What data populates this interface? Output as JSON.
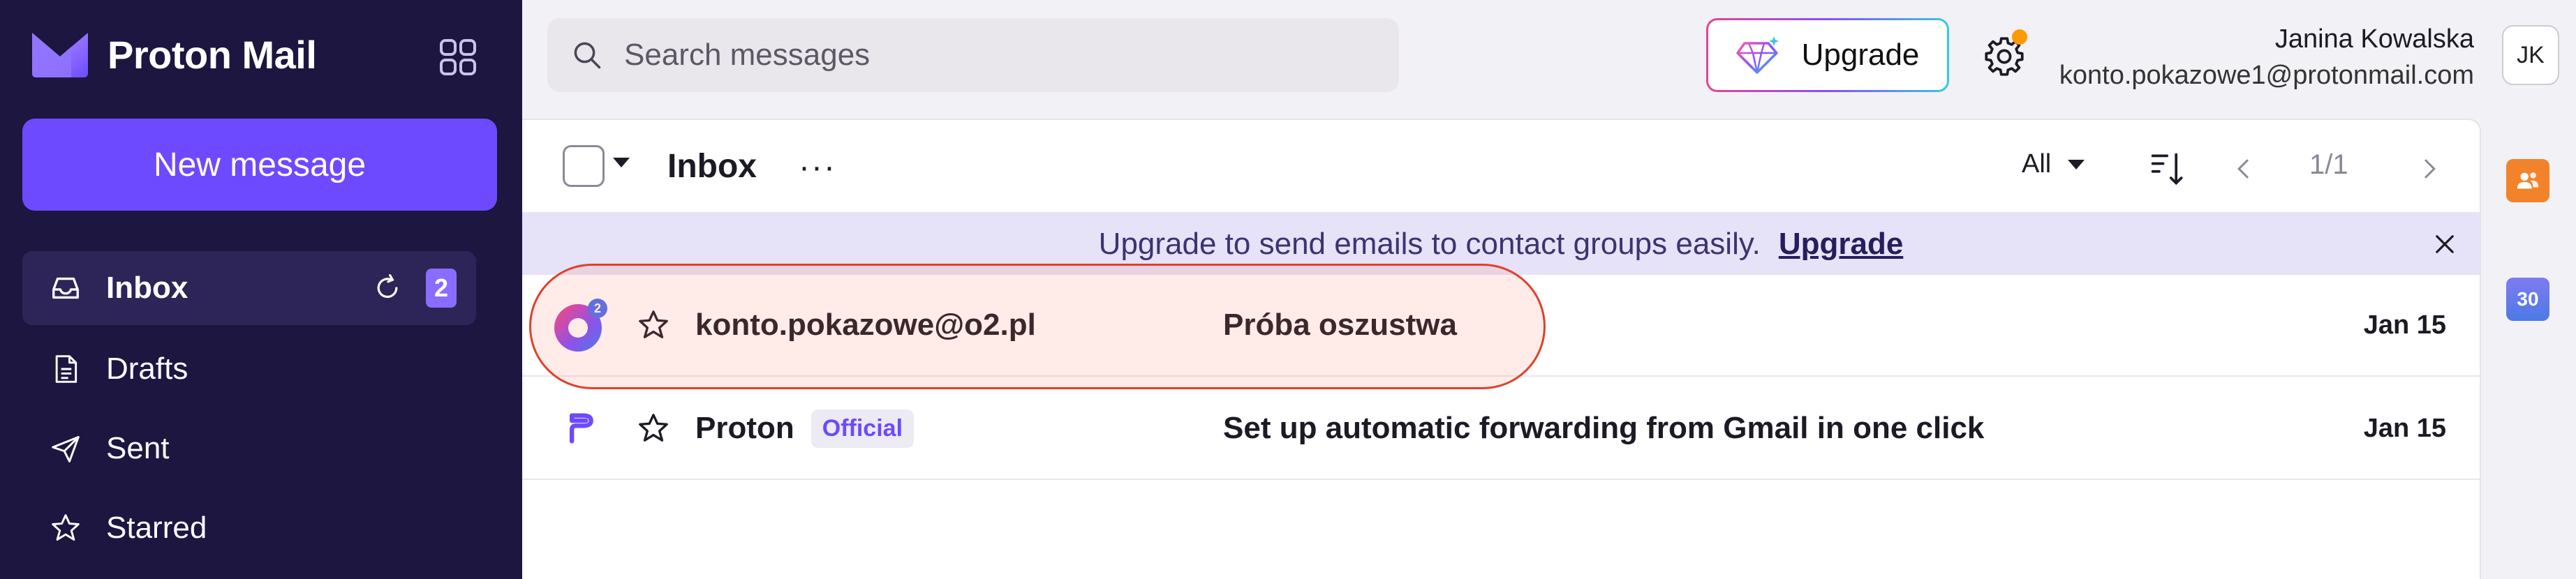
{
  "app": {
    "name": "Proton Mail"
  },
  "sidebar": {
    "new_message_label": "New message",
    "items": [
      {
        "label": "Inbox",
        "icon": "inbox-icon",
        "count": "2",
        "active": true
      },
      {
        "label": "Drafts",
        "icon": "drafts-icon"
      },
      {
        "label": "Sent",
        "icon": "sent-icon"
      },
      {
        "label": "Starred",
        "icon": "star-icon"
      }
    ]
  },
  "header": {
    "search_placeholder": "Search messages",
    "upgrade_label": "Upgrade",
    "user_name": "Janina Kowalska",
    "user_email": "konto.pokazowe1@protonmail.com",
    "avatar_initials": "JK"
  },
  "toolbar": {
    "folder_title": "Inbox",
    "more": "···",
    "filter_label": "All",
    "page_indicator": "1/1"
  },
  "banner": {
    "text": "Upgrade to send emails to contact groups easily.",
    "link_label": "Upgrade"
  },
  "messages": [
    {
      "sender": "konto.pokazowe@o2.pl",
      "subject": "Próba oszustwa",
      "date": "Jan 15",
      "avatar_badge": "2",
      "highlighted": true
    },
    {
      "sender": "Proton",
      "badge": "Official",
      "subject": "Set up automatic forwarding from Gmail in one click",
      "date": "Jan 15"
    }
  ],
  "right_rail": {
    "calendar_day": "30"
  },
  "colors": {
    "sidebar_bg": "#1c1640",
    "accent": "#6d4aff",
    "banner_bg": "#e6e2f7",
    "highlight_border": "#e0402a",
    "notification_dot": "#ff9900"
  }
}
